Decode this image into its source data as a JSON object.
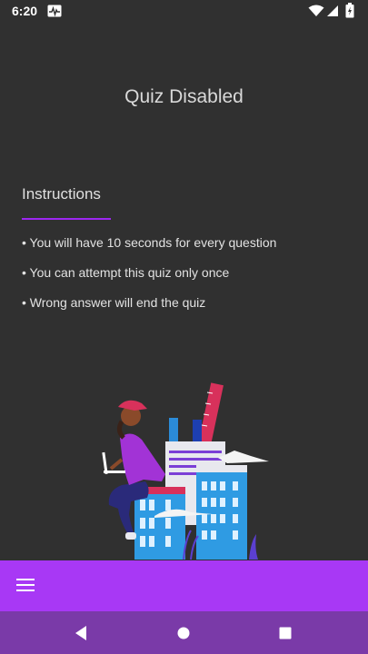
{
  "status_bar": {
    "time": "6:20",
    "icons": [
      "activity-icon",
      "wifi-icon",
      "signal-icon",
      "battery-icon"
    ]
  },
  "page": {
    "title": "Quiz Disabled",
    "instructions_heading": "Instructions",
    "instructions": [
      "• You will have 10 seconds for every question",
      "• You can attempt this quiz only once",
      "• Wrong answer will end the quiz"
    ]
  },
  "bottom_app_bar": {
    "icon": "menu-icon"
  },
  "nav_bar": {
    "icons": [
      "back-icon",
      "home-icon",
      "recents-icon"
    ]
  },
  "colors": {
    "background": "#303030",
    "accent": "#a838f5",
    "nav_bar": "#7a3aa8",
    "underline": "#9c27f0"
  }
}
